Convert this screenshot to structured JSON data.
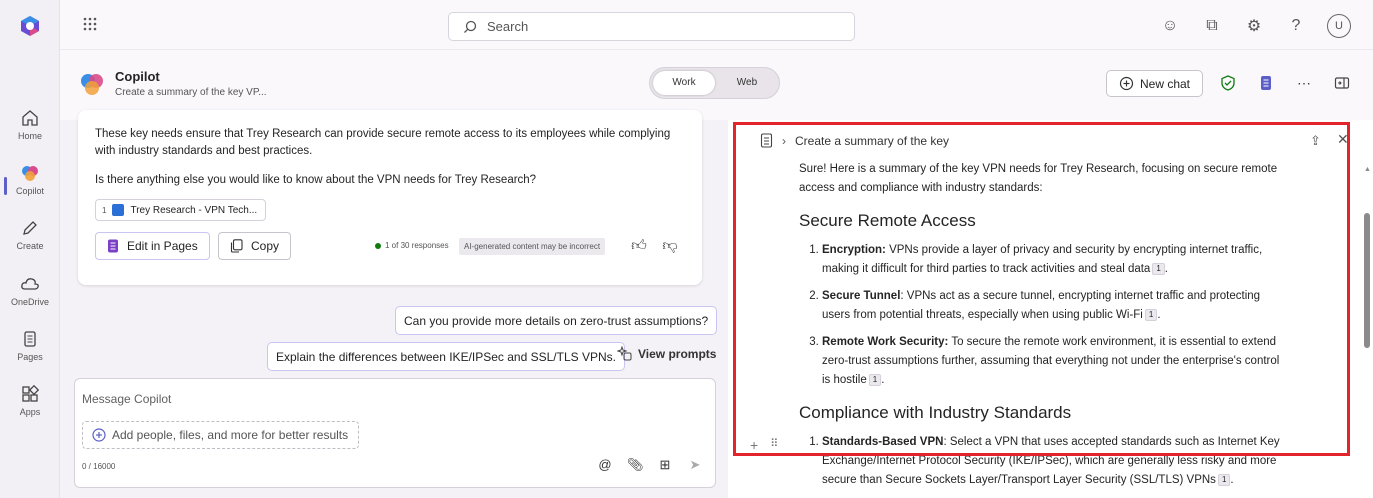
{
  "nav_rail": {
    "items": [
      {
        "label": "Home",
        "icon": "home-icon"
      },
      {
        "label": "Copilot",
        "icon": "copilot-icon",
        "active": true
      },
      {
        "label": "Create",
        "icon": "pen-icon"
      },
      {
        "label": "OneDrive",
        "icon": "cloud-icon"
      },
      {
        "label": "Pages",
        "icon": "pages-icon"
      },
      {
        "label": "Apps",
        "icon": "apps-icon"
      }
    ]
  },
  "topbar": {
    "search_placeholder": "Search",
    "avatar_initial": "U"
  },
  "header": {
    "title": "Copilot",
    "subtitle": "Create a summary of the key VP...",
    "mode_toggle": {
      "work": "Work",
      "web": "Web",
      "selected": "Work"
    },
    "new_chat_label": "New chat"
  },
  "chat": {
    "answer_paragraph_1": "These key needs ensure that Trey Research can provide secure remote access to its employees while complying with industry standards and best practices.",
    "answer_paragraph_2": "Is there anything else you would like to know about the VPN needs for Trey Research?",
    "citation": {
      "number": "1",
      "title": "Trey Research - VPN Tech..."
    },
    "edit_in_pages_label": "Edit in Pages",
    "copy_label": "Copy",
    "response_count": "1 of 30 responses",
    "ai_disclaimer": "AI-generated content may be incorrect",
    "suggested_prompts": [
      "Can you provide more details on zero-trust assumptions?",
      "Explain the differences between IKE/IPSec and SSL/TLS VPNs."
    ],
    "view_prompts_label": "View prompts"
  },
  "composer": {
    "placeholder": "Message Copilot",
    "add_label": "Add people, files, and more for better results",
    "char_count": "0 / 16000"
  },
  "pages_pane": {
    "breadcrumb": "Create a summary of the key",
    "intro": "Sure! Here is a summary of the key VPN needs for Trey Research, focusing on secure remote access and compliance with industry standards:",
    "section1_title": "Secure Remote Access",
    "section1_items": [
      {
        "term": "Encryption:",
        "text": " VPNs provide a layer of privacy and security by encrypting internet traffic, making it difficult for third parties to track activities and steal data",
        "ref": "1"
      },
      {
        "term": "Secure Tunnel",
        "text": ": VPNs act as a secure tunnel, encrypting internet traffic and protecting users from potential threats, especially when using public Wi-Fi",
        "ref": "1"
      },
      {
        "term": "Remote Work Security:",
        "text": " To secure the remote work environment, it is essential to extend zero-trust assumptions further, assuming that everything not under the enterprise's control is hostile",
        "ref": "1"
      }
    ],
    "section2_title": "Compliance with Industry Standards",
    "section2_items": [
      {
        "term": "Standards-Based VPN",
        "text": ": Select a VPN that uses accepted standards such as Internet Key Exchange/Internet Protocol Security (IKE/IPSec), which are generally less risky and more secure than Secure Sockets Layer/Transport Layer Security (SSL/TLS) VPNs",
        "ref": "1"
      }
    ]
  },
  "colors": {
    "accent": "#5b5fc7",
    "highlight_border": "#e3242b",
    "success_green": "#107c10"
  }
}
